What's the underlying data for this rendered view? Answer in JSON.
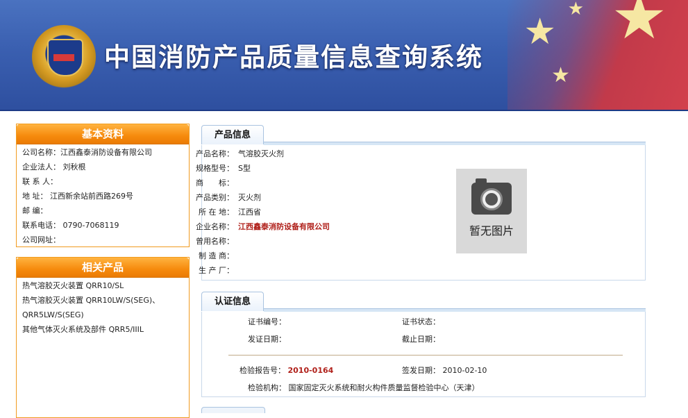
{
  "header": {
    "title": "中国消防产品质量信息查询系统"
  },
  "basic": {
    "title": "基本资料",
    "rows": [
      {
        "label": "公司名称：",
        "value": "江西鑫泰消防设备有限公司"
      },
      {
        "label": "企业法人：",
        "value": "刘秋根"
      },
      {
        "label": "联 系 人：",
        "value": ""
      },
      {
        "label": "地  址：",
        "value": "江西新余站前西路269号"
      },
      {
        "label": "邮  编：",
        "value": ""
      },
      {
        "label": "联系电话：",
        "value": "0790-7068119"
      },
      {
        "label": "公司网址：",
        "value": ""
      }
    ]
  },
  "related": {
    "title": "相关产品",
    "items": [
      "热气溶胶灭火装置 QRR10/SL",
      "热气溶胶灭火装置 QRR10LW/S(SEG)、",
      "QRR5LW/S(SEG)",
      "其他气体灭火系统及部件 QRR5/IIIL"
    ]
  },
  "product": {
    "tab": "产品信息",
    "rows": [
      {
        "label": "产品名称：",
        "value": "气溶胶灭火剂"
      },
      {
        "label": "规格型号：",
        "value": "S型"
      },
      {
        "label": "商　　标：",
        "value": ""
      },
      {
        "label": "产品类别：",
        "value": "灭火剂"
      },
      {
        "label": "所 在 地：",
        "value": "江西省"
      },
      {
        "label": "企业名称：",
        "value": "江西鑫泰消防设备有限公司"
      },
      {
        "label": "曾用名称：",
        "value": ""
      },
      {
        "label": "制 造 商：",
        "value": ""
      },
      {
        "label": "生 产 厂：",
        "value": ""
      }
    ],
    "photo_text": "暂无图片"
  },
  "cert": {
    "tab": "认证信息",
    "cert_no_label": "证书编号：",
    "cert_no": "",
    "cert_status_label": "证书状态：",
    "cert_status": "",
    "issue_date_label": "发证日期：",
    "issue_date": "",
    "expire_label": "截止日期：",
    "expire": "",
    "report_no_label": "检验报告号：",
    "report_no": "2010-0164",
    "sign_date_label": "签发日期：",
    "sign_date": "2010-02-10",
    "agency_label": "检验机构：",
    "agency": "国家固定灭火系统和耐火构件质量监督检验中心（天津）"
  },
  "colors": {
    "accent": "#f68a0d",
    "banner": "#3a5fb0",
    "red_text": "#b0201a"
  }
}
